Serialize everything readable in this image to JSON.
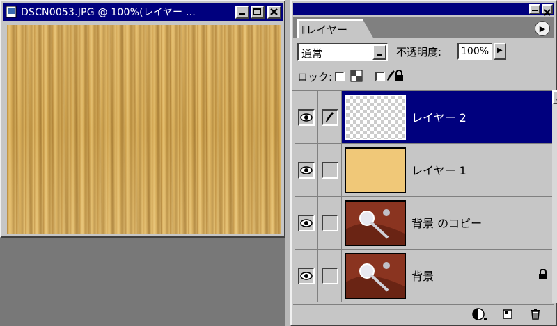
{
  "document_window": {
    "title": "DSCN0053.JPG @ 100%(レイヤー …",
    "texture_color": "#d8ae58"
  },
  "layers_panel": {
    "tab_label": "レイヤー",
    "blend_mode": "通常",
    "opacity_label": "不透明度:",
    "opacity_value": "100%",
    "lock_label": "ロック:",
    "layers": [
      {
        "name": "レイヤー 2",
        "selected": true,
        "thumbnail": "transparent"
      },
      {
        "name": "レイヤー 1",
        "selected": false,
        "thumbnail": "solid-tan"
      },
      {
        "name": "背景 のコピー",
        "selected": false,
        "thumbnail": "photo"
      },
      {
        "name": "背景",
        "selected": false,
        "thumbnail": "photo",
        "locked": true
      }
    ]
  },
  "colors": {
    "title_bar": "#00007e",
    "selection": "#00007e",
    "panel_gray": "#c6c6c6",
    "desktop": "#787878"
  }
}
